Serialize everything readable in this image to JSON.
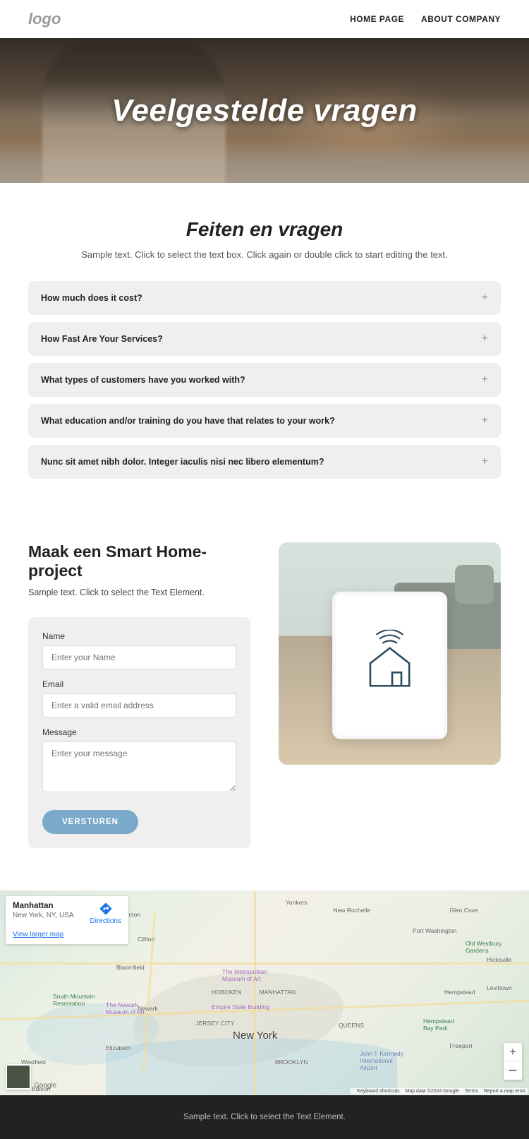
{
  "header": {
    "logo": "logo",
    "nav": {
      "home": "HOME PAGE",
      "about": "ABOUT COMPANY"
    }
  },
  "hero": {
    "title": "Veelgestelde vragen"
  },
  "faq": {
    "title": "Feiten en vragen",
    "subtitle": "Sample text. Click to select the text box. Click again or double click to start editing the text.",
    "items": [
      {
        "q": "How much does it cost?"
      },
      {
        "q": "How Fast Are Your Services?"
      },
      {
        "q": "What types of customers have you worked with?"
      },
      {
        "q": "What education and/or training do you have that relates to your work?"
      },
      {
        "q": "Nunc sit amet nibh dolor. Integer iaculis nisi nec libero elementum?"
      }
    ]
  },
  "contact": {
    "title": "Maak een Smart Home-project",
    "subtitle": "Sample text. Click to select the Text Element.",
    "form": {
      "name_label": "Name",
      "name_ph": "Enter your Name",
      "email_label": "Email",
      "email_ph": "Enter a valid email address",
      "msg_label": "Message",
      "msg_ph": "Enter your message",
      "submit": "VERSTUREN"
    }
  },
  "map": {
    "card_title": "Manhattan",
    "card_addr": "New York, NY, USA",
    "directions": "Directions",
    "larger": "View larger map",
    "city": "New York",
    "labels": {
      "manhattan": "MANHATTAN",
      "brooklyn": "BROOKLYN",
      "queens": "QUEENS",
      "newark": "Newark",
      "jersey": "JERSEY CITY",
      "hempstead": "Hempstead",
      "bloomfield": "Bloomfield",
      "paterson": "Paterson",
      "clifton": "Clifton",
      "yonkers": "Yonkers",
      "newrochelle": "New Rochelle",
      "hoboken": "HOBOKEN",
      "hicksville": "Hicksville",
      "levittown": "Levittown",
      "westfield": "Westfield",
      "elizabeth": "Elizabeth",
      "edison": "Edison",
      "southmtn": "South Mountain Reservation",
      "oldwestbury": "Old Westbury Gardens",
      "met": "The Metropolitan Museum of Art",
      "empire": "Empire State Building",
      "newarkmus": "The Newark Museum of Art",
      "jfk": "John F Kennedy International Airport",
      "freeport": "Freeport",
      "glencove": "Glen Cove",
      "portwash": "Port Washington",
      "baypark": "Hempstead Bay Park"
    },
    "glogo": "Google",
    "attrib": {
      "kb": "Keyboard shortcuts",
      "data": "Map data ©2024 Google",
      "terms": "Terms",
      "report": "Report a map error"
    }
  },
  "footer": {
    "text": "Sample text. Click to select the Text Element."
  }
}
